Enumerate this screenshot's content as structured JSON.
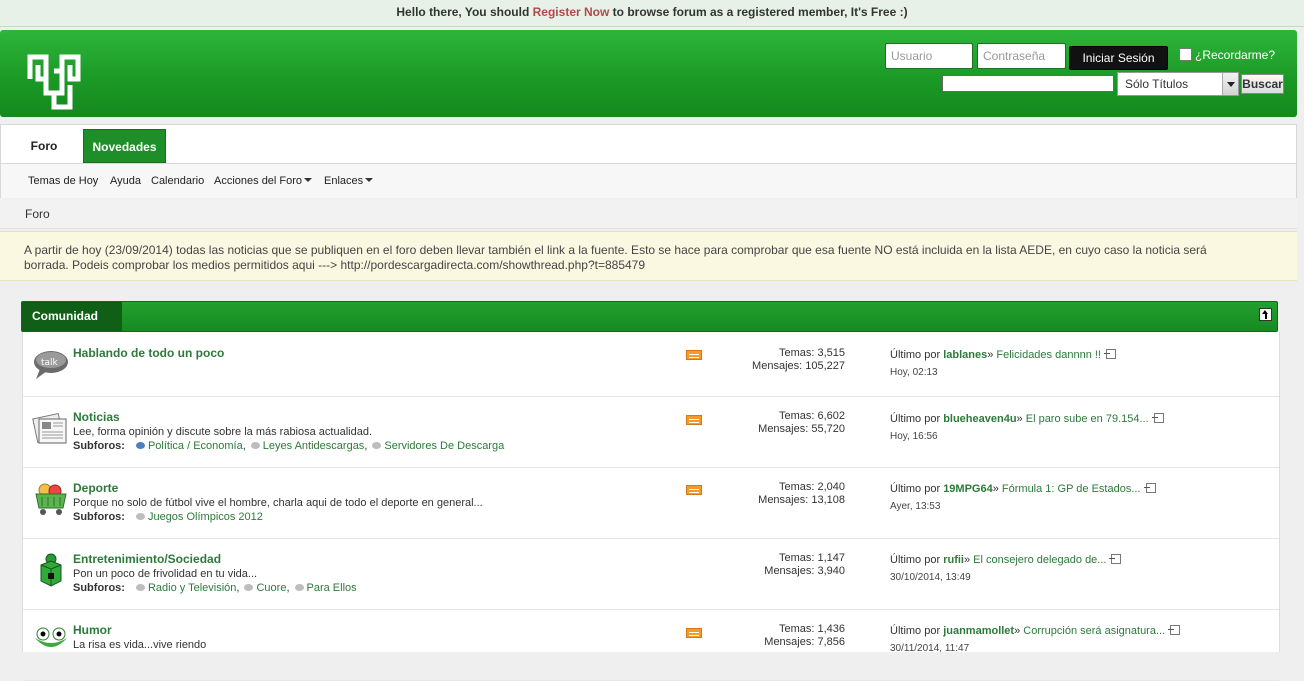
{
  "notice": {
    "prefix": "Hello there, You should ",
    "link": "Register Now",
    "suffix": " to browse forum as a registered member, It's Free :)"
  },
  "header": {
    "logo": "pordescargadirecta-logo",
    "username_placeholder": "Usuario",
    "password_placeholder": "Contraseña",
    "login_label": "Iniciar Sesión",
    "remember_label": "¿Recordarme?",
    "search_value": "",
    "search_select": "Sólo Títulos",
    "search_button": "Buscar"
  },
  "nav": {
    "tabs": [
      "Foro",
      "Novedades"
    ],
    "subnav": [
      "Temas de Hoy",
      "Ayuda",
      "Calendario",
      "Acciones del Foro",
      "Enlaces"
    ]
  },
  "breadcrumb": "Foro",
  "announcement": "A partir de hoy (23/09/2014) todas las noticias que se publiquen en el foro deben llevar también el link a la fuente. Esto se hace para comprobar que esa fuente NO está incluida en la lista AEDE, en cuyo caso la noticia será borrada. Podeis comprobar los medios permitidos aqui ---> http://pordescargadirecta.com/showthread.php?t=885479",
  "section": {
    "title": "Comunidad"
  },
  "subforums_label": "Subforos:",
  "lastpost_prefix": "Último por ",
  "forums": [
    {
      "title": "Hablando de todo un poco",
      "icon": "talk-bubble-icon",
      "desc": "",
      "subforums": [],
      "rss": true,
      "temas": "Temas: 3,515",
      "mensajes": "Mensajes: 105,227",
      "last_user": "lablanes",
      "last_thread": "Felicidades dannnn !!",
      "last_date": "Hoy, 02:13"
    },
    {
      "title": "Noticias",
      "icon": "newspaper-icon",
      "desc": "Lee, forma opinión y discute sobre la más rabiosa actualidad.",
      "subforums": [
        "Política / Economía",
        "Leyes Antidescargas",
        "Servidores De Descarga"
      ],
      "rss": true,
      "temas": "Temas: 6,602",
      "mensajes": "Mensajes: 55,720",
      "last_user": "blueheaven4u",
      "last_thread": "El paro sube en 79.154...",
      "last_date": "Hoy, 16:56"
    },
    {
      "title": "Deporte",
      "icon": "sports-cart-icon",
      "desc": "Porque no solo de fútbol vive el hombre, charla aqui de todo el deporte en general...",
      "subforums": [
        "Juegos Olímpicos 2012"
      ],
      "rss": true,
      "temas": "Temas: 2,040",
      "mensajes": "Mensajes: 13,108",
      "last_user": "19MPG64",
      "last_thread": "Fórmula 1: GP de Estados...",
      "last_date": "Ayer, 13:53"
    },
    {
      "title": "Entretenimiento/Sociedad",
      "icon": "person-cube-icon",
      "desc": "Pon un poco de frivolidad en tu vida...",
      "subforums": [
        "Radio y Televisión",
        "Cuore",
        "Para Ellos"
      ],
      "rss": false,
      "temas": "Temas: 1,147",
      "mensajes": "Mensajes: 3,940",
      "last_user": "rufii",
      "last_thread": "El consejero delegado de...",
      "last_date": "30/10/2014, 13:49"
    },
    {
      "title": "Humor",
      "icon": "frog-face-icon",
      "desc": "La risa es vida...vive riendo",
      "subforums": [],
      "rss": true,
      "temas": "Temas: 1,436",
      "mensajes": "Mensajes: 7,856",
      "last_user": "juanmamollet",
      "last_thread": "Corrupción será asignatura...",
      "last_date": "30/11/2014, 11:47"
    }
  ]
}
